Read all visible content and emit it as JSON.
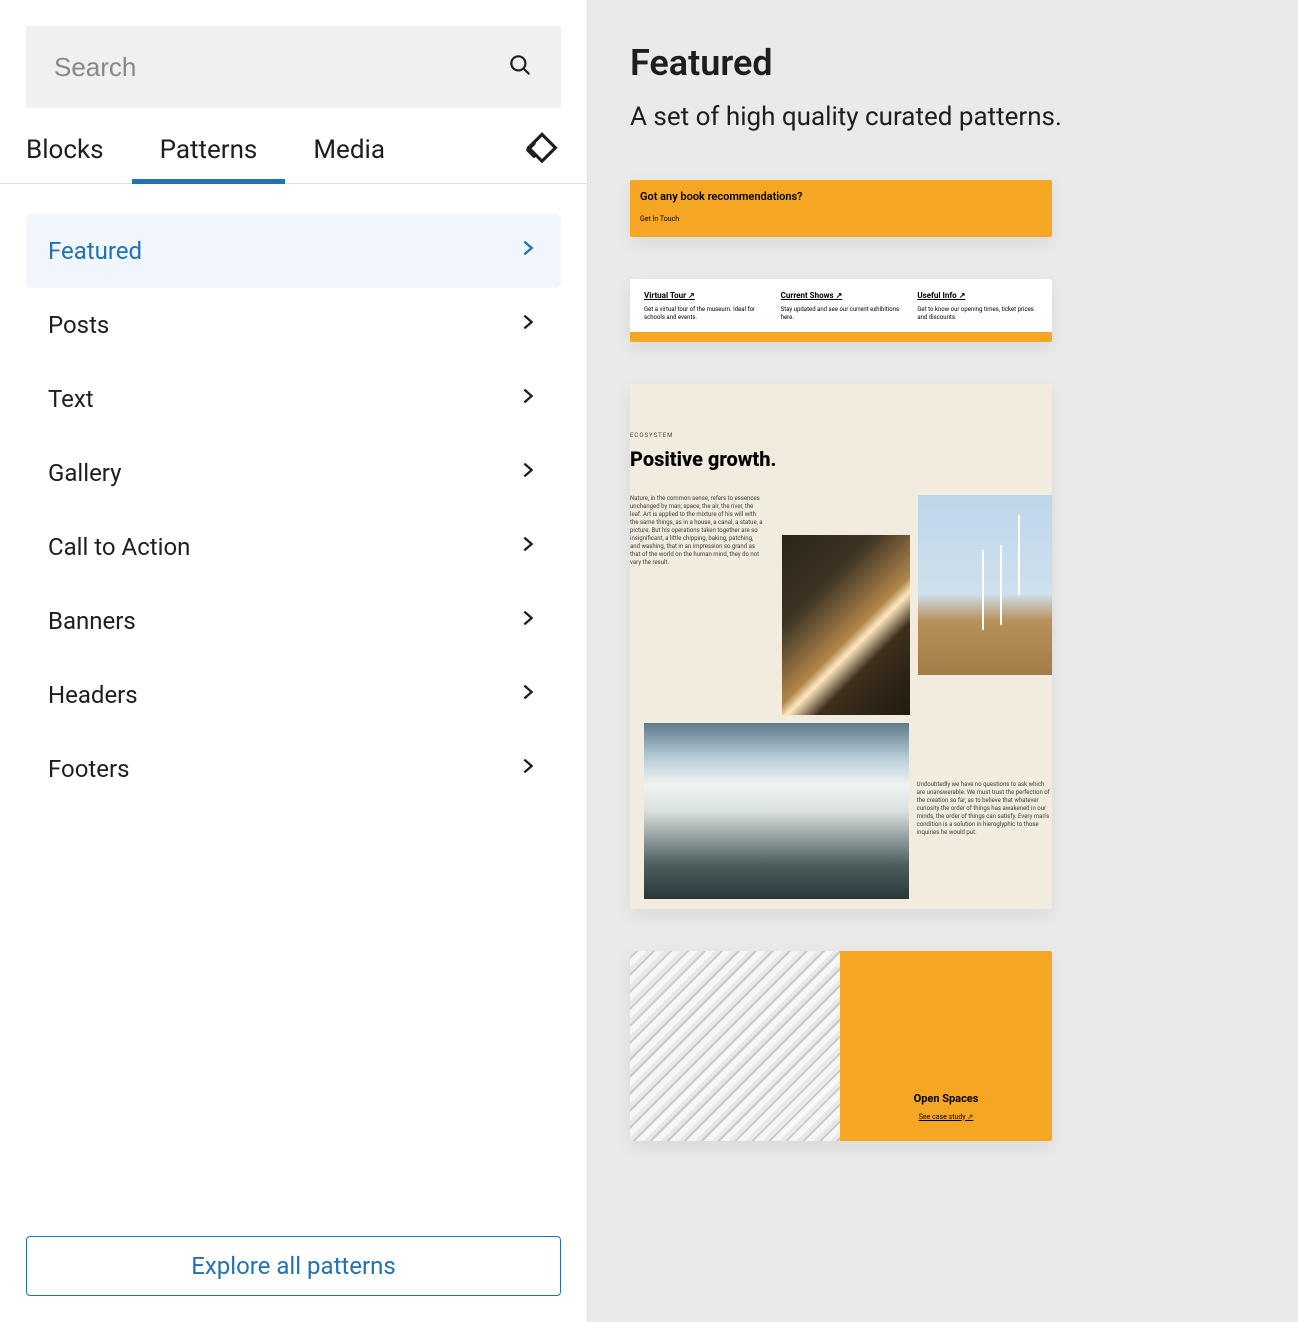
{
  "search": {
    "placeholder": "Search"
  },
  "tabs": {
    "blocks": "Blocks",
    "patterns": "Patterns",
    "media": "Media",
    "active": "patterns"
  },
  "categories": [
    {
      "label": "Featured",
      "active": true
    },
    {
      "label": "Posts"
    },
    {
      "label": "Text"
    },
    {
      "label": "Gallery"
    },
    {
      "label": "Call to Action"
    },
    {
      "label": "Banners"
    },
    {
      "label": "Headers"
    },
    {
      "label": "Footers"
    }
  ],
  "explore_button": "Explore all patterns",
  "preview": {
    "title": "Featured",
    "subtitle": "A set of high quality curated patterns.",
    "patterns": {
      "p1": {
        "heading": "Got any book recommendations?",
        "button": "Get In Touch"
      },
      "p2": {
        "cols": [
          {
            "title": "Virtual Tour ↗",
            "desc": "Get a virtual tour of the museum. Ideal for schools and events."
          },
          {
            "title": "Current Shows ↗",
            "desc": "Stay updated and see our current exhibitions here."
          },
          {
            "title": "Useful Info ↗",
            "desc": "Get to know our opening times, ticket prices and discounts."
          }
        ]
      },
      "p3": {
        "kicker": "ECOSYSTEM",
        "headline": "Positive growth.",
        "para1": "Nature, in the common sense, refers to essences unchanged by man; space, the air, the river, the leaf. Art is applied to the mixture of his will with the same things, as in a house, a canal, a statue, a picture. But his operations taken together are so insignificant, a little chipping, baking, patching, and washing, that in an impression so grand as that of the world on the human mind, they do not vary the result.",
        "para2": "Undoubtedly we have no questions to ask which are unanswerable. We must trust the perfection of the creation so far, as to believe that whatever curiosity the order of things has awakened in our minds, the order of things can satisfy. Every man's condition is a solution in hieroglyphic to those inquiries he would put."
      },
      "p4": {
        "title": "Open Spaces",
        "link": "See case study ↗"
      }
    }
  }
}
